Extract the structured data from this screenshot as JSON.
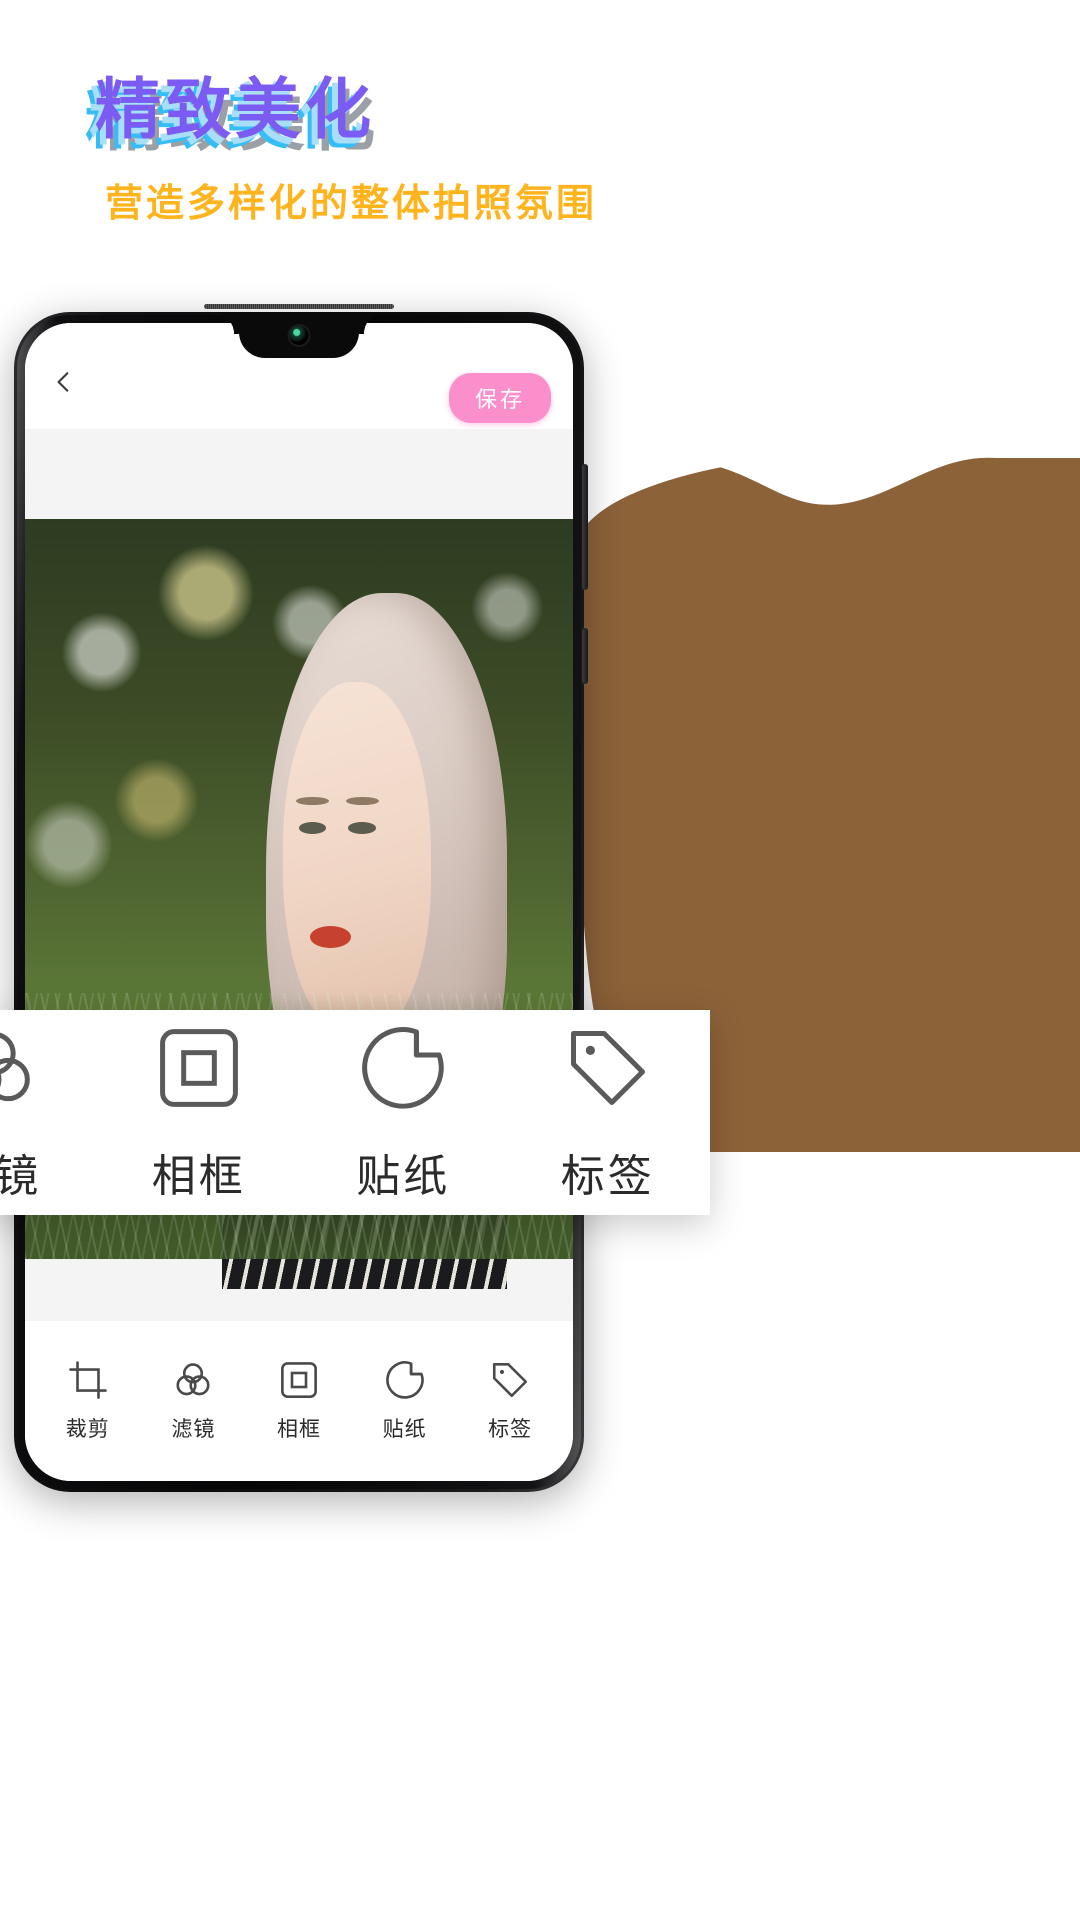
{
  "promo": {
    "headline": "精致美化",
    "subheadline": "营造多样化的整体拍照氛围",
    "headline_colors": [
      "#7B5BF2",
      "#35BDF5",
      "#A8DEF7",
      "#9AA0A6"
    ],
    "subheadline_color": "#FFB41E"
  },
  "decoration": {
    "blob_color": "#8C6239"
  },
  "phone": {
    "appbar": {
      "back_icon": "chevron-left-icon",
      "save_label": "保存",
      "save_color": "#FB8FCB"
    },
    "canvas": {
      "photo_alt": "portrait-photo",
      "background_color": "#F4F4F4"
    },
    "toolbar": {
      "items": [
        {
          "label": "裁剪",
          "icon": "crop-icon"
        },
        {
          "label": "滤镜",
          "icon": "filter-circles-icon"
        },
        {
          "label": "相框",
          "icon": "frame-icon"
        },
        {
          "label": "贴纸",
          "icon": "sticker-icon"
        },
        {
          "label": "标签",
          "icon": "tag-icon"
        }
      ]
    }
  },
  "float_panel": {
    "items": [
      {
        "label": "滤镜",
        "icon": "filter-circles-icon"
      },
      {
        "label": "相框",
        "icon": "frame-icon"
      },
      {
        "label": "贴纸",
        "icon": "sticker-icon"
      },
      {
        "label": "标签",
        "icon": "tag-icon"
      }
    ]
  }
}
